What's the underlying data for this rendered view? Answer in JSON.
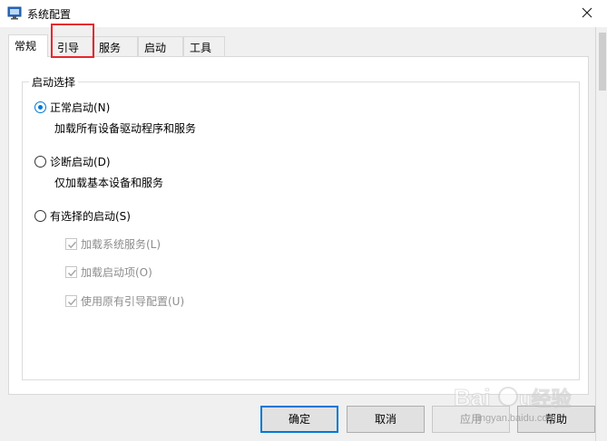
{
  "window": {
    "title": "系统配置"
  },
  "tabs": [
    {
      "label": "常规",
      "active": true
    },
    {
      "label": "引导",
      "active": false,
      "highlighted": true
    },
    {
      "label": "服务",
      "active": false
    },
    {
      "label": "启动",
      "active": false
    },
    {
      "label": "工具",
      "active": false
    }
  ],
  "startup_group": {
    "title": "启动选择",
    "options": [
      {
        "label": "正常启动(N)",
        "description": "加载所有设备驱动程序和服务",
        "selected": true
      },
      {
        "label": "诊断启动(D)",
        "description": "仅加载基本设备和服务",
        "selected": false
      },
      {
        "label": "有选择的启动(S)",
        "selected": false
      }
    ],
    "selective_items": [
      {
        "label": "加载系统服务(L)",
        "checked": true,
        "enabled": false
      },
      {
        "label": "加载启动项(O)",
        "checked": true,
        "enabled": false
      },
      {
        "label": "使用原有引导配置(U)",
        "checked": true,
        "enabled": false
      }
    ]
  },
  "buttons": {
    "ok": "确定",
    "cancel": "取消",
    "apply": "应用",
    "help": "帮助"
  },
  "watermark": {
    "text": "Baidu经验",
    "subtext": "jingyan.baidu.com"
  },
  "colors": {
    "accent": "#0078d7",
    "highlight_box": "#e8262d",
    "dialog_bg": "#f0f0f0"
  }
}
